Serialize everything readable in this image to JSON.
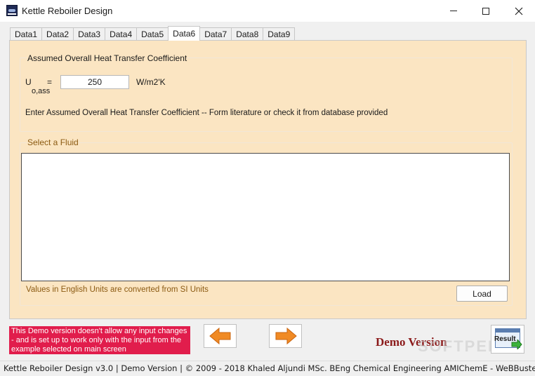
{
  "window": {
    "title": "Kettle Reboiler Design"
  },
  "tabs": [
    {
      "label": "Data1"
    },
    {
      "label": "Data2"
    },
    {
      "label": "Data3"
    },
    {
      "label": "Data4"
    },
    {
      "label": "Data5"
    },
    {
      "label": "Data6",
      "active": true
    },
    {
      "label": "Data7"
    },
    {
      "label": "Data8"
    },
    {
      "label": "Data9"
    }
  ],
  "heat_transfer": {
    "group_title": "Assumed Overall Heat Transfer Coefficient",
    "symbol": "U",
    "subscript": "o,ass",
    "equals": "=",
    "value": "250",
    "unit": "W/m2'K",
    "hint": "Enter Assumed Overall Heat Transfer Coefficient -- Form literature or check it from database provided"
  },
  "fluid": {
    "group_title": "Select a Fluid",
    "items": [],
    "units_note": "Values in English Units are converted from SI Units",
    "load_label": "Load"
  },
  "footer": {
    "demo_notice": "This Demo version doesn't allow any input changes - and is set up to work only with the input from the example selected on main screen",
    "demo_version_label": "Demo Version",
    "result_label": "Result",
    "prev_icon": "left-arrow-icon",
    "next_icon": "right-arrow-icon"
  },
  "statusbar": {
    "text": "Kettle Reboiler Design  v3.0  |  Demo Version  |  © 2009 - 2018 Khaled Aljundi MSc. BEng Chemical Engineering AMIChemE - WeBBusterZ"
  },
  "watermark": "SOFTPEDIA",
  "colors": {
    "page_background": "#fbe5c2",
    "demo_box": "#e11d4c",
    "demo_version_text": "#8b1a1a",
    "arrow_orange": "#f08a24",
    "group2_title": "#8b5a12"
  }
}
